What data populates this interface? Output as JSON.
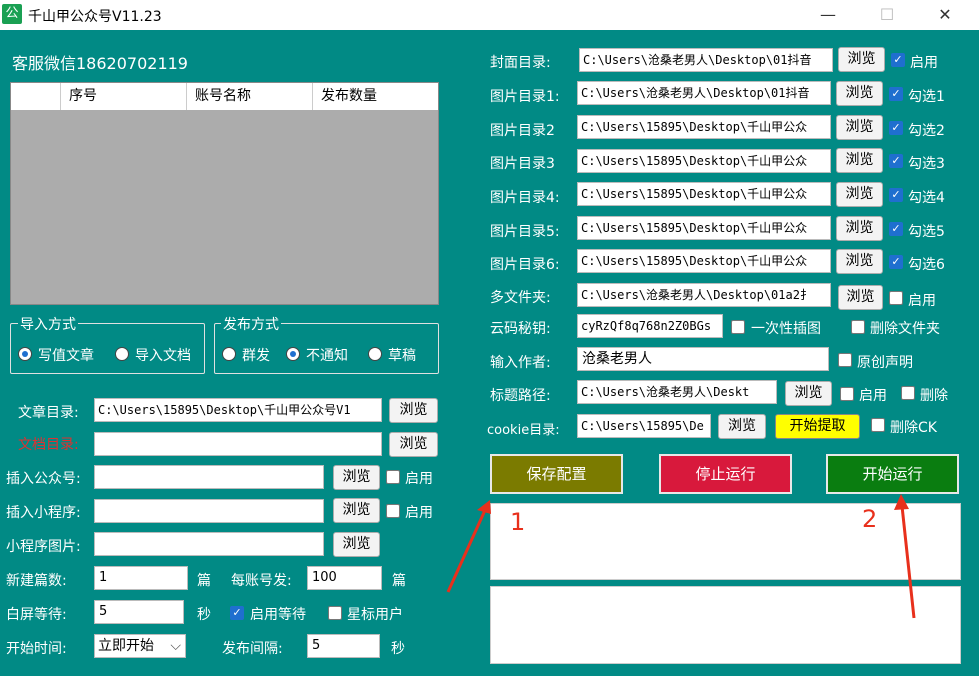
{
  "window": {
    "icon": "公",
    "title": "千山甲公众号V11.23",
    "min": "—",
    "max": "☐",
    "close": "✕"
  },
  "left": {
    "service": "客服微信18620702119",
    "table_headers": [
      "",
      "序号",
      "账号名称",
      "发布数量"
    ],
    "import_group": {
      "title": "导入方式",
      "opt1": "写值文章",
      "opt2": "导入文档"
    },
    "publish_group": {
      "title": "发布方式",
      "opt1": "群发",
      "opt2": "不通知",
      "opt3": "草稿"
    },
    "article_dir": {
      "label": "文章目录:",
      "value": "C:\\Users\\15895\\Desktop\\千山甲公众号V1"
    },
    "doc_dir": {
      "label": "文档目录:",
      "value": ""
    },
    "insert_public": {
      "label": "插入公众号:",
      "value": "",
      "enable": "启用"
    },
    "insert_mini": {
      "label": "插入小程序:",
      "value": "",
      "enable": "启用"
    },
    "mini_image": {
      "label": "小程序图片:",
      "value": ""
    },
    "browse": "浏览",
    "new_count": {
      "label": "新建篇数:",
      "value": "1",
      "unit": "篇"
    },
    "per_account": {
      "label": "每账号发:",
      "value": "100",
      "unit": "篇"
    },
    "white_wait": {
      "label": "白屏等待:",
      "value": "5",
      "unit": "秒"
    },
    "enable_wait": "启用等待",
    "star_user": "星标用户",
    "start_time": {
      "label": "开始时间:",
      "value": "立即开始"
    },
    "interval": {
      "label": "发布间隔:",
      "value": "5",
      "unit": "秒"
    }
  },
  "right": {
    "cover": {
      "label": "封面目录:",
      "value": "C:\\Users\\沧桑老男人\\Desktop\\01抖音",
      "check": "启用"
    },
    "img1": {
      "label": "图片目录1:",
      "value": "C:\\Users\\沧桑老男人\\Desktop\\01抖音",
      "check": "勾选1"
    },
    "img2": {
      "label": "图片目录2",
      "value": "C:\\Users\\15895\\Desktop\\千山甲公众",
      "check": "勾选2"
    },
    "img3": {
      "label": "图片目录3",
      "value": "C:\\Users\\15895\\Desktop\\千山甲公众",
      "check": "勾选3"
    },
    "img4": {
      "label": "图片目录4:",
      "value": "C:\\Users\\15895\\Desktop\\千山甲公众",
      "check": "勾选4"
    },
    "img5": {
      "label": "图片目录5:",
      "value": "C:\\Users\\15895\\Desktop\\千山甲公众",
      "check": "勾选5"
    },
    "img6": {
      "label": "图片目录6:",
      "value": "C:\\Users\\15895\\Desktop\\千山甲公众",
      "check": "勾选6"
    },
    "multi": {
      "label": "多文件夹:",
      "value": "C:\\Users\\沧桑老男人\\Desktop\\01a2扌",
      "check": "启用"
    },
    "yunma": {
      "label": "云码秘钥:",
      "value": "cyRzQf8q768n2Z0BGs",
      "opt1": "一次性插图",
      "opt2": "删除文件夹"
    },
    "author": {
      "label": "输入作者:",
      "value": "沧桑老男人",
      "check": "原创声明"
    },
    "title_path": {
      "label": "标题路径:",
      "value": "C:\\Users\\沧桑老男人\\Deskt",
      "check1": "启用",
      "check2": "删除"
    },
    "cookie": {
      "label": "cookie目录:",
      "value": "C:\\Users\\15895\\De",
      "fetch": "开始提取",
      "check": "删除CK"
    },
    "browse": "浏览",
    "save": "保存配置",
    "stop": "停止运行",
    "start": "开始运行"
  },
  "annotations": {
    "n1": "1",
    "n2": "2"
  },
  "colors": {
    "bg": "#018a85",
    "save": "#7b7b00",
    "stop": "#d8193c",
    "start": "#0a7d10",
    "fetch": "#ffff00"
  }
}
